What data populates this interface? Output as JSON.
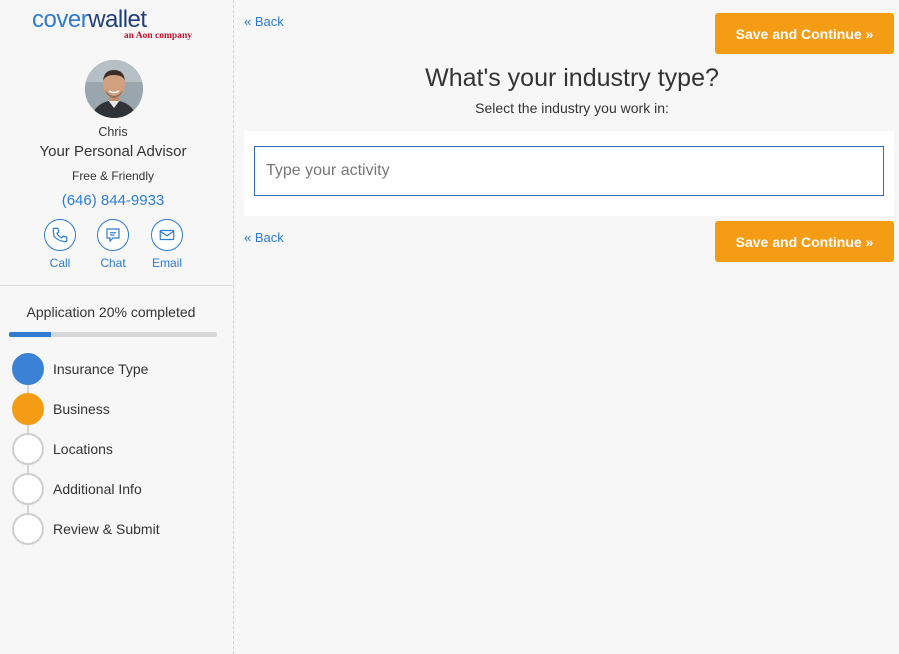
{
  "brand": {
    "logo_cover": "cover",
    "logo_wallet": "wallet",
    "tagline": "an Aon company"
  },
  "advisor": {
    "name": "Chris",
    "title": "Your Personal Advisor",
    "tagline": "Free & Friendly",
    "phone": "(646) 844-9933",
    "contacts": [
      {
        "label": "Call",
        "icon": "phone-icon"
      },
      {
        "label": "Chat",
        "icon": "chat-icon"
      },
      {
        "label": "Email",
        "icon": "email-icon"
      }
    ]
  },
  "progress": {
    "label": "Application 20% completed",
    "percent": 20
  },
  "steps": [
    {
      "label": "Insurance Type",
      "state": "done"
    },
    {
      "label": "Business",
      "state": "current"
    },
    {
      "label": "Locations",
      "state": "pending"
    },
    {
      "label": "Additional Info",
      "state": "pending"
    },
    {
      "label": "Review & Submit",
      "state": "pending"
    }
  ],
  "main": {
    "back_label": "« Back",
    "continue_label": "Save and Continue »",
    "title": "What's your industry type?",
    "subtitle": "Select the industry you work in:",
    "activity_input": {
      "value": "",
      "placeholder": "Type your activity"
    }
  },
  "colors": {
    "brand_blue": "#2e7bd0",
    "accent_orange": "#f49d14",
    "step_done": "#3b82d6"
  }
}
